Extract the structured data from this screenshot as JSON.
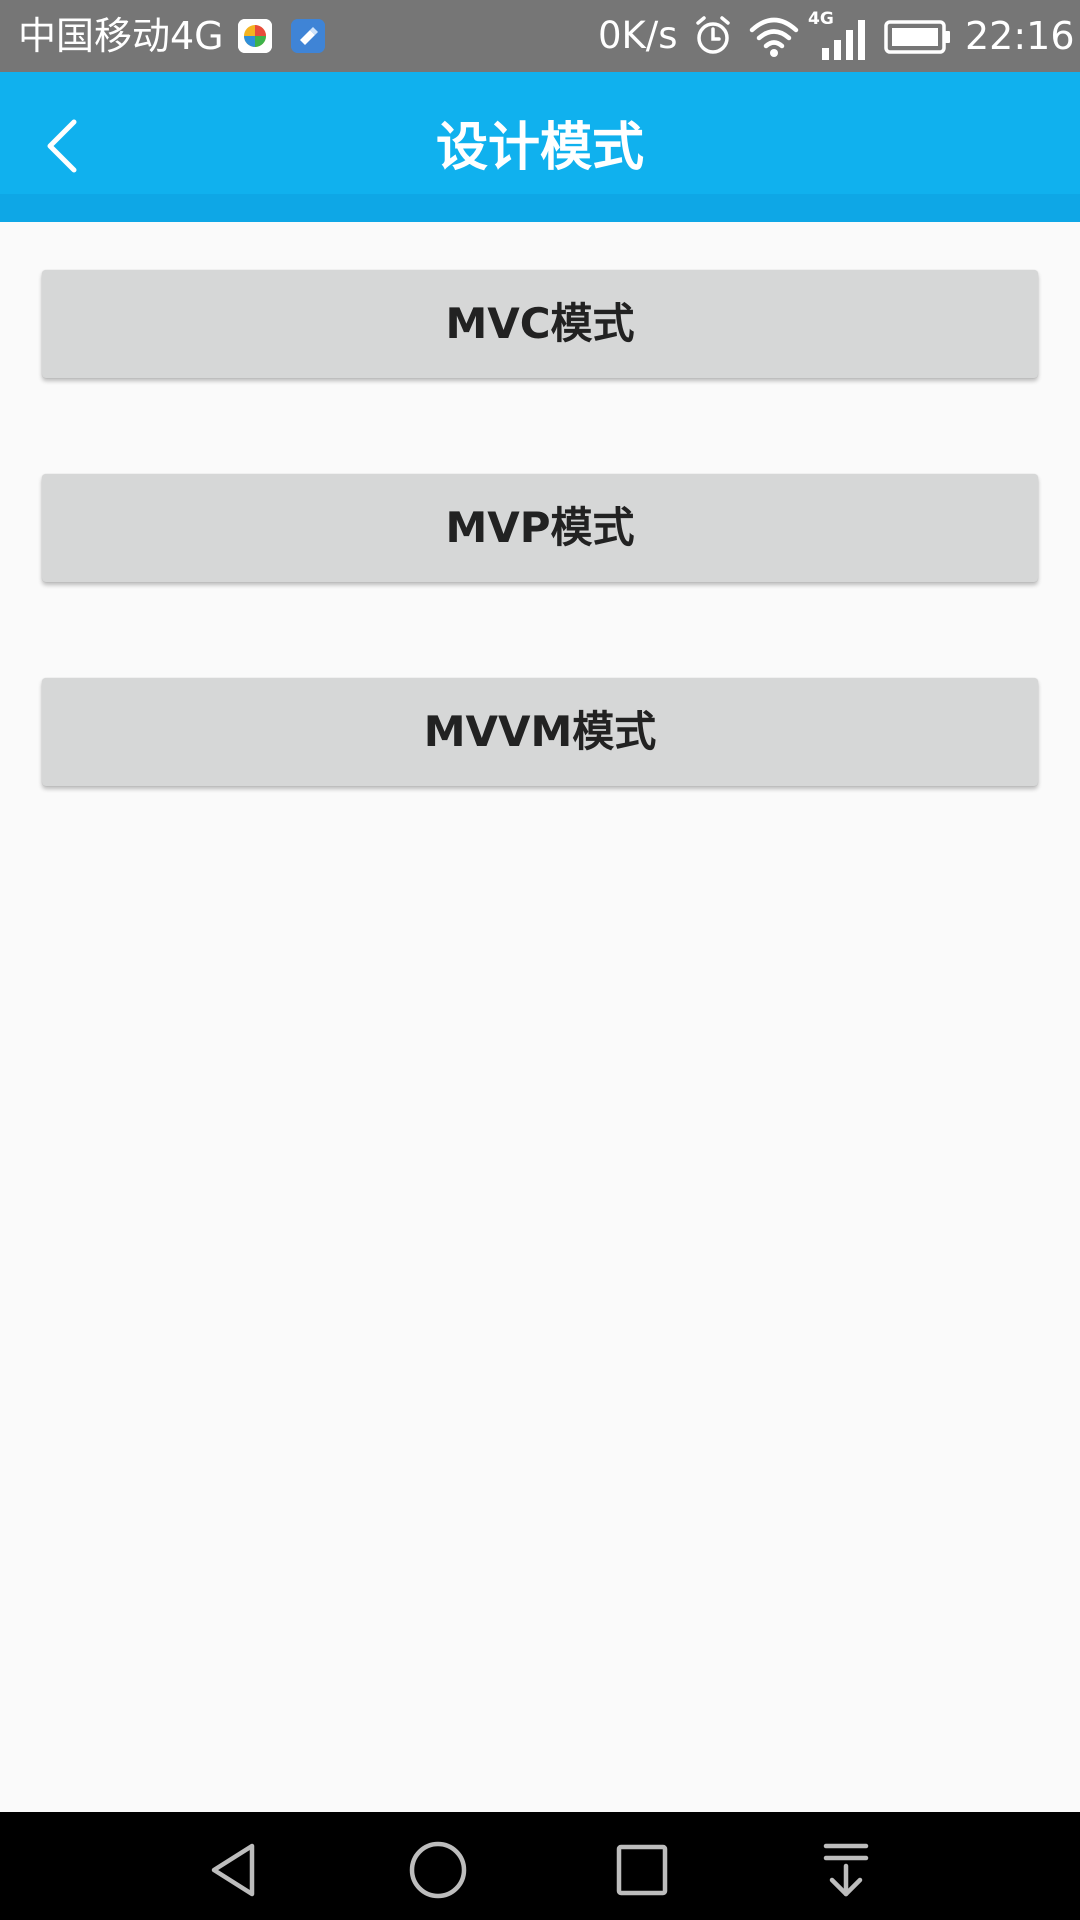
{
  "status_bar": {
    "carrier": "中国移动4G",
    "network_speed": "0K/s",
    "signal_label": "4G",
    "time": "22:16"
  },
  "app_bar": {
    "title": "设计模式",
    "background_color": "#10b1ee"
  },
  "buttons": [
    {
      "label": "MVC模式"
    },
    {
      "label": "MVP模式"
    },
    {
      "label": "MVVM模式"
    }
  ],
  "icons": {
    "status": [
      "game-app-icon",
      "cleaner-app-icon",
      "alarm-icon",
      "wifi-icon",
      "cell-signal-icon",
      "battery-icon"
    ],
    "app_bar": [
      "back-arrow-icon"
    ],
    "navigation": [
      "back-nav-icon",
      "home-nav-icon",
      "recents-nav-icon",
      "notifications-pull-icon"
    ]
  }
}
